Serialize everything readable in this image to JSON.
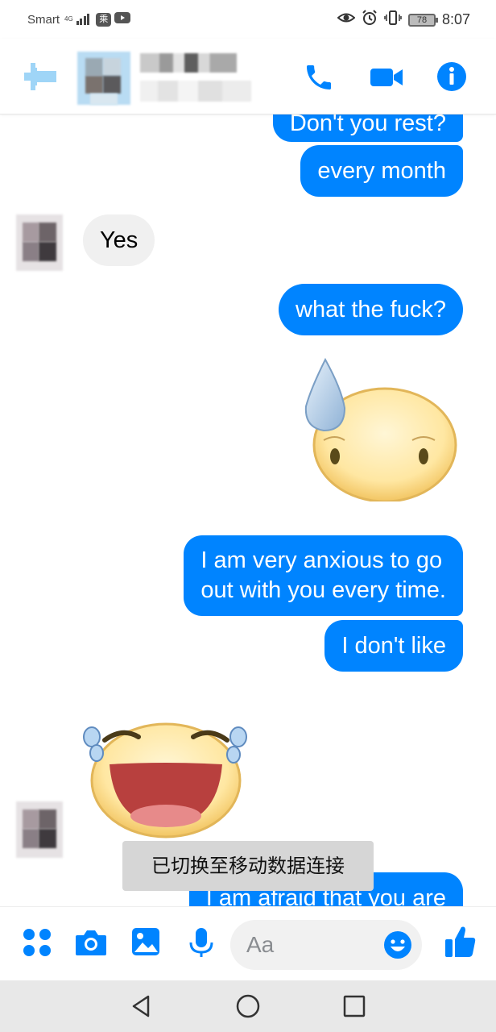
{
  "status_bar": {
    "carrier": "Smart",
    "network_type": "4G",
    "carrier_badge": "乘",
    "battery": "78",
    "time": "8:07"
  },
  "header": {
    "icons": [
      "back-arrow-icon",
      "phone-icon",
      "video-camera-icon",
      "info-icon"
    ],
    "brand_color": "#0084ff"
  },
  "messages": [
    {
      "direction": "out",
      "text": "Don't you rest?"
    },
    {
      "direction": "out",
      "text": "every month"
    },
    {
      "direction": "in",
      "text": "Yes"
    },
    {
      "direction": "out",
      "text": "what the fuck?"
    },
    {
      "direction": "out",
      "sticker": "nervous-sweat-sticker"
    },
    {
      "direction": "out",
      "text_lines": [
        "I am very anxious to go",
        "out with you every time."
      ]
    },
    {
      "direction": "out",
      "text": "I don't like"
    },
    {
      "direction": "in",
      "sticker": "laughing-tears-sticker"
    },
    {
      "direction": "out",
      "text": "I am afraid that you are"
    }
  ],
  "toast": "已切换至移动数据连接",
  "composer": {
    "placeholder": "Aa",
    "icons": [
      "apps-grid-icon",
      "camera-icon",
      "gallery-icon",
      "microphone-icon",
      "emoji-icon",
      "thumbs-up-icon"
    ]
  },
  "navbar": {
    "icons": [
      "back-triangle-icon",
      "home-circle-icon",
      "recents-square-icon"
    ]
  },
  "colors": {
    "outgoing_bubble": "#0084ff",
    "incoming_bubble": "#f0f0f0",
    "toast_bg": "#d6d6d6"
  }
}
